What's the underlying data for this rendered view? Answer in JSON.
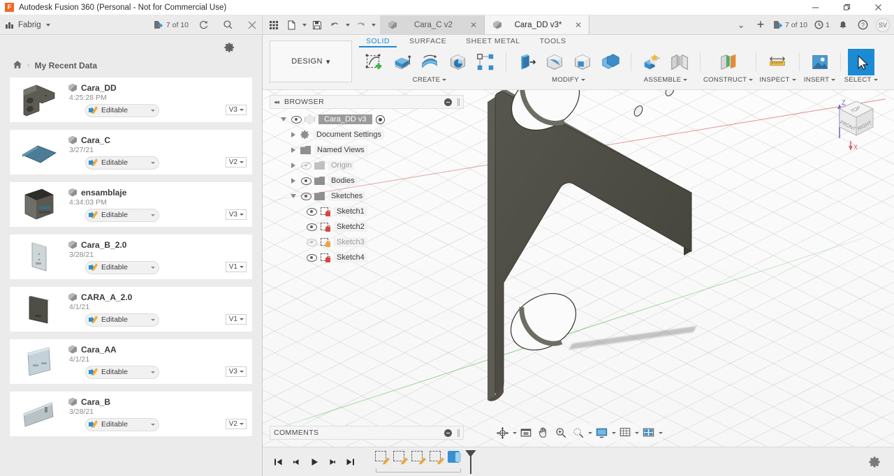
{
  "window": {
    "title": "Autodesk Fusion 360 (Personal - Not for Commercial Use)",
    "logo_letter": "F",
    "minimize": "—",
    "maximize": "❐",
    "close": "✕"
  },
  "app_bar": {
    "team_name": "Fabrig",
    "team_caret": "▾",
    "jobs_status": "7 of 10",
    "refresh_icon": "refresh-icon",
    "search_icon": "search-icon",
    "close_panel_icon": "close-icon"
  },
  "quick_access": {
    "grid_icon": "app-grid-icon",
    "new_icon": "new-file-icon",
    "save_icon": "save-icon",
    "undo_icon": "undo-icon",
    "redo_icon": "redo-icon"
  },
  "tabs": [
    {
      "label": "Cara_C v2",
      "active": false,
      "close": "✕"
    },
    {
      "label": "Cara_DD v3*",
      "active": true,
      "close": "✕"
    }
  ],
  "tab_tools": {
    "dropdown": "⌄",
    "add": "+",
    "jobs_status": "7 of 10",
    "notifications_count": "1",
    "bell_icon": "bell-icon",
    "help_icon": "help-icon",
    "avatar_initials": "SV"
  },
  "data_panel": {
    "settings_icon": "gear-icon",
    "breadcrumb_home": "⌂",
    "breadcrumb_sep": "›",
    "breadcrumb_label": "My Recent Data",
    "items": [
      {
        "name": "Cara_DD",
        "date": "4:25:28 PM",
        "state": "Editable",
        "version": "V3",
        "thumb": "bracket-dark"
      },
      {
        "name": "Cara_C",
        "date": "3/27/21",
        "state": "Editable",
        "version": "V2",
        "thumb": "plate-blue"
      },
      {
        "name": "ensamblaje",
        "date": "4:34:03 PM",
        "state": "Editable",
        "version": "V3",
        "thumb": "assembly-box"
      },
      {
        "name": "Cara_B_2.0",
        "date": "3/28/21",
        "state": "Editable",
        "version": "V1",
        "thumb": "panel-light"
      },
      {
        "name": "CARA_A_2.0",
        "date": "4/1/21",
        "state": "Editable",
        "version": "V1",
        "thumb": "panel-dark"
      },
      {
        "name": "Cara_AA",
        "date": "4/1/21",
        "state": "Editable",
        "version": "V3",
        "thumb": "panel-blue"
      },
      {
        "name": "Cara_B",
        "date": "3/28/21",
        "state": "Editable",
        "version": "V2",
        "thumb": "panel-grey"
      }
    ]
  },
  "ribbon": {
    "workspace": "DESIGN",
    "workspace_caret": "▾",
    "tabs": [
      {
        "label": "SOLID",
        "active": true
      },
      {
        "label": "SURFACE",
        "active": false
      },
      {
        "label": "SHEET METAL",
        "active": false
      },
      {
        "label": "TOOLS",
        "active": false
      }
    ],
    "groups": [
      {
        "label": "CREATE",
        "caret": "▾",
        "icons": [
          "new-sketch-icon",
          "extrude-icon",
          "revolve-icon",
          "sweep-icon",
          "pattern-icon"
        ]
      },
      {
        "label": "MODIFY",
        "caret": "▾",
        "icons": [
          "press-pull-icon",
          "fillet-icon",
          "shell-icon",
          "combine-icon"
        ]
      },
      {
        "label": "ASSEMBLE",
        "caret": "▾",
        "icons": [
          "new-component-icon",
          "joint-icon"
        ]
      },
      {
        "label": "CONSTRUCT",
        "caret": "▾",
        "icons": [
          "offset-plane-icon"
        ]
      },
      {
        "label": "INSPECT",
        "caret": "▾",
        "icons": [
          "measure-icon"
        ]
      },
      {
        "label": "INSERT",
        "caret": "▾",
        "icons": [
          "insert-image-icon"
        ]
      },
      {
        "label": "SELECT",
        "caret": "▾",
        "icons": [
          "select-cursor-icon"
        ]
      }
    ],
    "accent_color": "#1a8bd4"
  },
  "browser": {
    "title": "BROWSER",
    "collapse_icon": "◂◂",
    "options_icon": "minus-circle-icon",
    "nodes": [
      {
        "label": "Cara_DD v3",
        "level": 0,
        "expander": "open",
        "eye": "on",
        "icon": "component-icon",
        "selected": true,
        "radio": true
      },
      {
        "label": "Document Settings",
        "level": 1,
        "expander": "closed",
        "eye": "none",
        "icon": "gear-icon"
      },
      {
        "label": "Named Views",
        "level": 1,
        "expander": "closed",
        "eye": "none",
        "icon": "folder-icon"
      },
      {
        "label": "Origin",
        "level": 1,
        "expander": "closed",
        "eye": "off",
        "icon": "folder-icon"
      },
      {
        "label": "Bodies",
        "level": 1,
        "expander": "closed",
        "eye": "on",
        "icon": "folder-icon"
      },
      {
        "label": "Sketches",
        "level": 1,
        "expander": "open",
        "eye": "on",
        "icon": "folder-icon"
      },
      {
        "label": "Sketch1",
        "level": 2,
        "expander": "none",
        "eye": "on",
        "icon": "sketch-locked-icon"
      },
      {
        "label": "Sketch2",
        "level": 2,
        "expander": "none",
        "eye": "on",
        "icon": "sketch-locked-icon"
      },
      {
        "label": "Sketch3",
        "level": 2,
        "expander": "none",
        "eye": "off",
        "icon": "sketch-edit-icon"
      },
      {
        "label": "Sketch4",
        "level": 2,
        "expander": "none",
        "eye": "on",
        "icon": "sketch-locked-icon"
      }
    ]
  },
  "viewcube": {
    "face_top": "TOP",
    "face_front": "FRONT",
    "face_right": "RIGHT",
    "axis_z": "Z",
    "axis_x": "X"
  },
  "comments": {
    "title": "COMMENTS",
    "add_icon": "add-comment-icon"
  },
  "nav_toolbar": {
    "buttons": [
      {
        "icon": "orbit-icon",
        "caret": true
      },
      {
        "icon": "look-at-icon",
        "caret": false
      },
      {
        "icon": "pan-icon",
        "caret": false
      },
      {
        "icon": "zoom-icon",
        "caret": false
      },
      {
        "icon": "fit-icon",
        "caret": true
      },
      {
        "icon": "display-settings-icon",
        "caret": true
      },
      {
        "icon": "grid-snap-icon",
        "caret": true
      },
      {
        "icon": "viewports-icon",
        "caret": true
      }
    ]
  },
  "timeline": {
    "playback": [
      "go-to-beginning-icon",
      "step-back-icon",
      "play-icon",
      "step-forward-icon",
      "go-to-end-icon"
    ],
    "features": [
      {
        "type": "sketch",
        "name": "timeline-sketch-1"
      },
      {
        "type": "sketch",
        "name": "timeline-sketch-2"
      },
      {
        "type": "sketch",
        "name": "timeline-sketch-3"
      },
      {
        "type": "sketch",
        "name": "timeline-sketch-4"
      },
      {
        "type": "extrude",
        "name": "timeline-extrude-1"
      }
    ],
    "settings_icon": "gear-icon"
  },
  "canvas": {
    "model_name": "Cara_DD bracket",
    "body_color": "#4a4942",
    "grid_visible": true,
    "axis_red": "#d66464",
    "axis_green": "#6ec86e"
  }
}
